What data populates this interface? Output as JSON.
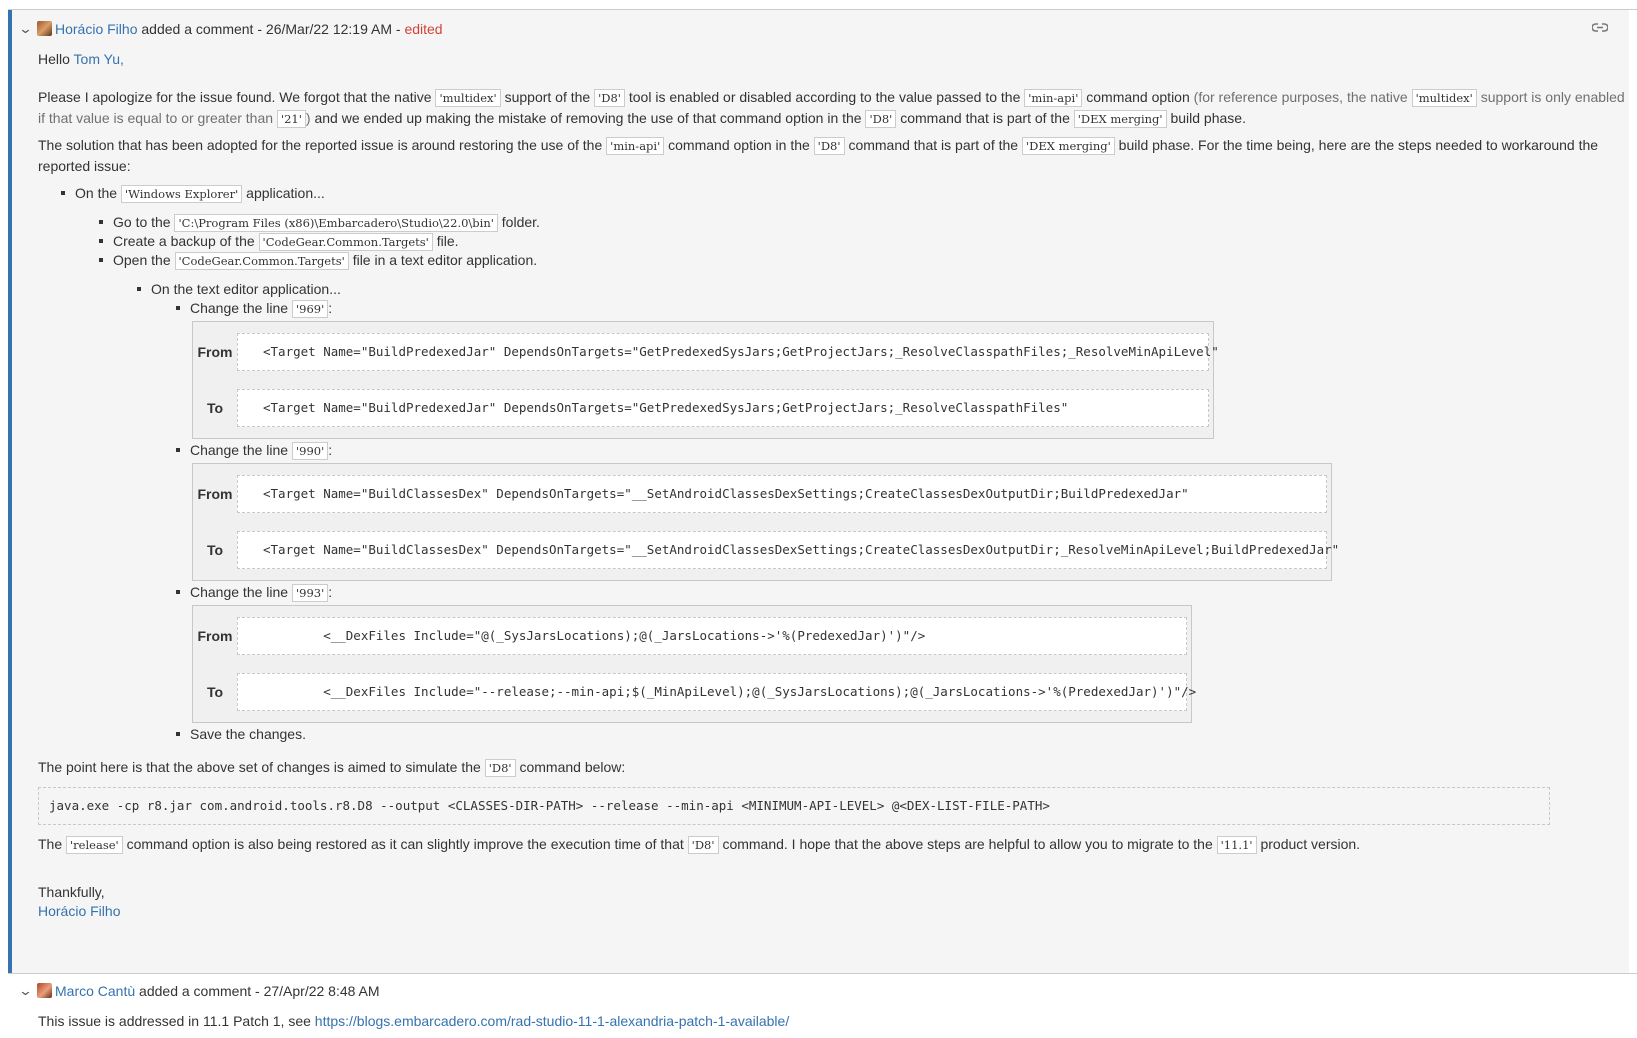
{
  "comment1": {
    "author": "Horácio Filho",
    "action": "added a comment",
    "date": "26/Mar/22 12:19 AM",
    "edited": "edited",
    "greeting_prefix": "Hello",
    "greeting_name": "Tom Yu,",
    "p1": {
      "t1": "Please I apologize for the issue found. We forgot that the native",
      "c1": "'multidex'",
      "t2": "support of the",
      "c2": "'D8'",
      "t3": "tool is enabled or disabled according to the value passed to the",
      "c3": "'min-api'",
      "t4": "command option",
      "m1": "(for reference purposes, the native",
      "c4": "'multidex'",
      "m2": "support is only enabled if that value is equal to or greater than",
      "c5": "'21'",
      "m3": ")",
      "t5": "and we ended up making the mistake of removing the use of that command option in the",
      "c6": "'D8'",
      "t6": "command that is part of the",
      "c7": "'DEX merging'",
      "t7": "build phase."
    },
    "p2": {
      "t1": "The solution that has been adopted for the reported issue is around restoring the use of the",
      "c1": "'min-api'",
      "t2": "command option in the",
      "c2": "'D8'",
      "t3": "command that is part of the",
      "c3": "'DEX merging'",
      "t4": "build phase. For the time being, here are the steps needed to workaround the reported issue:"
    },
    "step1": {
      "t1": "On the",
      "c1": "'Windows Explorer'",
      "t2": "application..."
    },
    "step1a": {
      "t1": "Go to the",
      "c1": "'C:\\Program Files (x86)\\Embarcadero\\Studio\\22.0\\bin'",
      "t2": "folder."
    },
    "step1b": {
      "t1": "Create a backup of the",
      "c1": "'CodeGear.Common.Targets'",
      "t2": "file."
    },
    "step1c": {
      "t1": "Open the",
      "c1": "'CodeGear.Common.Targets'",
      "t2": "file in a text editor application."
    },
    "step2": {
      "t1": "On the text editor application..."
    },
    "changes": [
      {
        "label_prefix": "Change the line",
        "line": "'969'",
        "label_suffix": ":",
        "from_label": "From",
        "from_code": "<Target Name=\"BuildPredexedJar\" DependsOnTargets=\"GetPredexedSysJars;GetProjectJars;_ResolveClasspathFiles;_ResolveMinApiLevel\"",
        "to_label": "To",
        "to_code": "<Target Name=\"BuildPredexedJar\" DependsOnTargets=\"GetPredexedSysJars;GetProjectJars;_ResolveClasspathFiles\""
      },
      {
        "label_prefix": "Change the line",
        "line": "'990'",
        "label_suffix": ":",
        "from_label": "From",
        "from_code": "<Target Name=\"BuildClassesDex\" DependsOnTargets=\"__SetAndroidClassesDexSettings;CreateClassesDexOutputDir;BuildPredexedJar\"",
        "to_label": "To",
        "to_code": "<Target Name=\"BuildClassesDex\" DependsOnTargets=\"__SetAndroidClassesDexSettings;CreateClassesDexOutputDir;_ResolveMinApiLevel;BuildPredexedJar\""
      },
      {
        "label_prefix": "Change the line",
        "line": "'993'",
        "label_suffix": ":",
        "from_label": "From",
        "from_code": "        <__DexFiles Include=\"@(_SysJarsLocations);@(_JarsLocations->'%(PredexedJar)')\"/>",
        "to_label": "To",
        "to_code": "        <__DexFiles Include=\"--release;--min-api;$(_MinApiLevel);@(_SysJarsLocations);@(_JarsLocations->'%(PredexedJar)')\"/>"
      }
    ],
    "save": "Save the changes.",
    "p3": {
      "t1": "The point here is that the above set of changes is aimed to simulate the",
      "c1": "'D8'",
      "t2": "command below:"
    },
    "command": "java.exe -cp r8.jar com.android.tools.r8.D8 --output <CLASSES-DIR-PATH> --release --min-api <MINIMUM-API-LEVEL> @<DEX-LIST-FILE-PATH>",
    "p4": {
      "t1": "The",
      "c1": "'release'",
      "t2": "command option is also being restored as it can slightly improve the execution time of that",
      "c2": "'D8'",
      "t3": "command. I hope that the above steps are helpful to allow you to migrate to the",
      "c3": "'11.1'",
      "t4": "product version."
    },
    "closing": "Thankfully,",
    "signature": "Horácio Filho"
  },
  "comment2": {
    "author": "Marco Cantù",
    "action": "added a comment",
    "date": "27/Apr/22 8:48 AM",
    "body_text": "This issue is addressed in 11.1 Patch 1, see",
    "link": "https://blogs.embarcadero.com/rad-studio-11-1-alexandria-patch-1-available/"
  },
  "icons": {
    "collapse": "chevron-down-icon",
    "permalink": "link-icon",
    "avatar": "avatar-image"
  },
  "colors": {
    "link": "#3572b0",
    "edited": "#d04437",
    "accent_bar": "#3572b0",
    "comment_bg": "#f5f5f5"
  }
}
